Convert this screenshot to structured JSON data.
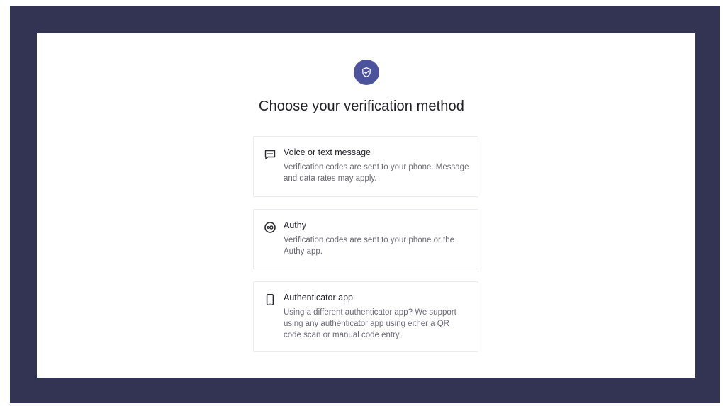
{
  "page": {
    "title": "Choose your verification method"
  },
  "header": {
    "icon": "shield-check-icon",
    "accent_color": "#4c529c"
  },
  "options": [
    {
      "icon": "message-icon",
      "name": "Voice or text message",
      "description": "Verification codes are sent to your phone. Message and data rates may apply."
    },
    {
      "icon": "authy-icon",
      "name": "Authy",
      "description": "Verification codes are sent to your phone or the Authy app."
    },
    {
      "icon": "smartphone-icon",
      "name": "Authenticator app",
      "description": "Using a different authenticator app? We support using any authenticator app using either a QR code scan or manual code entry."
    }
  ],
  "colors": {
    "frame": "#333354",
    "card": "#ffffff",
    "border": "#ececf0",
    "text": "#1f1f24",
    "muted": "#6a6a72"
  }
}
